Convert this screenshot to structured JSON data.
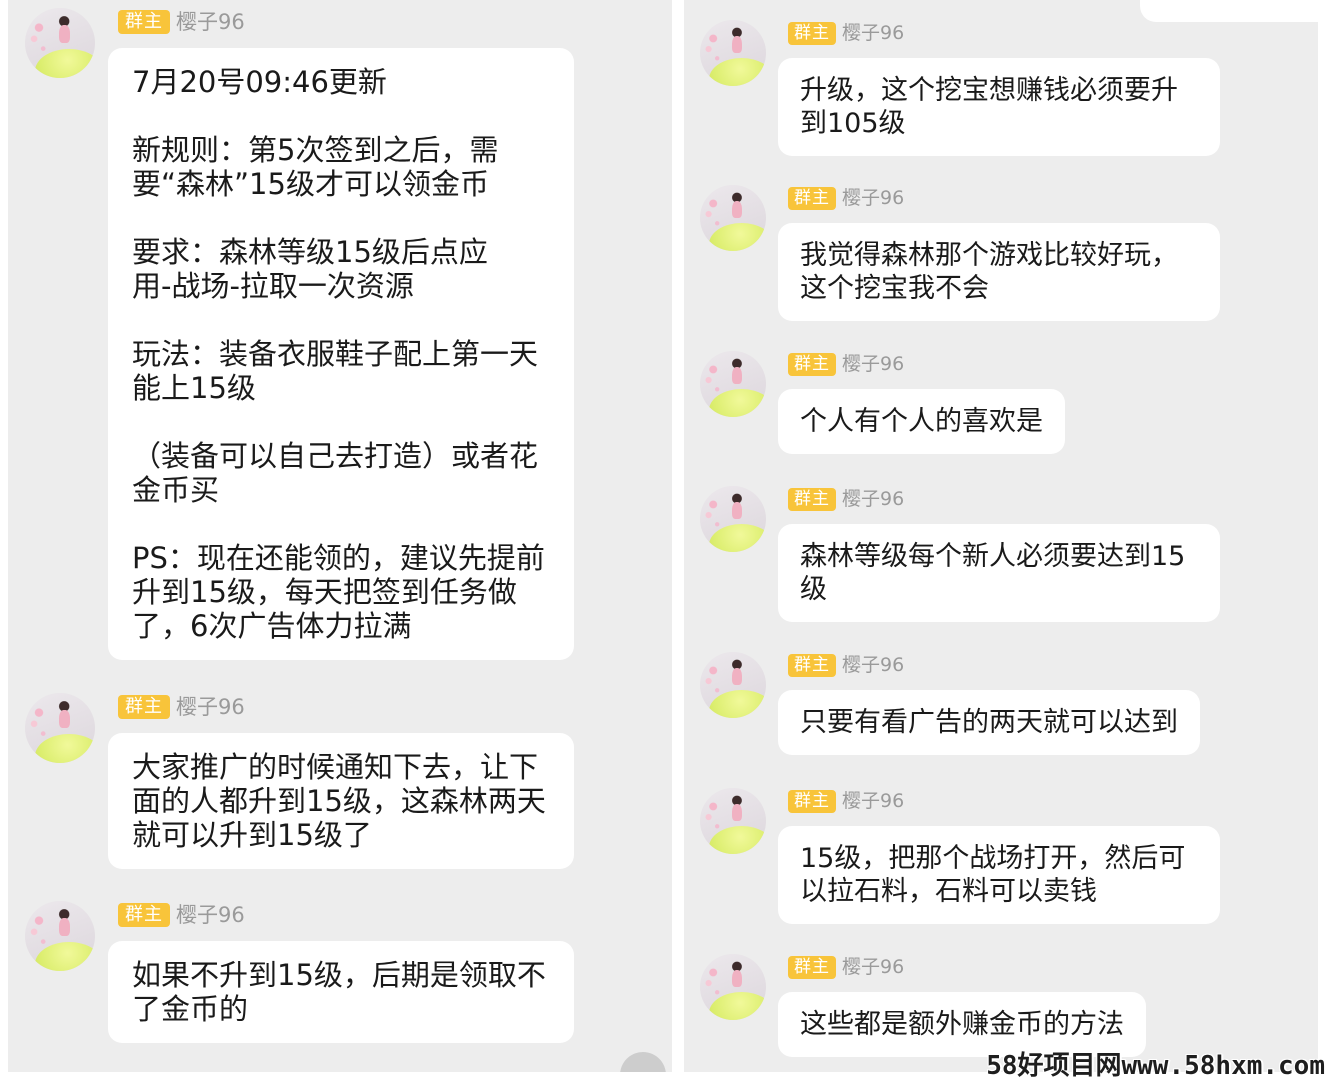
{
  "avatar_icon": "girl-in-green-dress-avatar",
  "colors": {
    "panel_bg": "#ededed",
    "bubble_bg": "#ffffff",
    "badge_bg": "#f8c43a",
    "badge_text": "#ffffff",
    "sender_name": "#9a9a9a",
    "message_text": "#1a1a1a"
  },
  "left": {
    "messages": [
      {
        "badge": "群主",
        "sender": "樱子96",
        "paragraphs": [
          [
            "7月20号09:46更新"
          ],
          [
            "新规则：第5次签到之后，需",
            "要“森林”15级才可以领金币"
          ],
          [
            "要求：森林等级15级后点应",
            "用-战场-拉取一次资源"
          ],
          [
            "玩法：装备衣服鞋子配上第一天",
            "能上15级"
          ],
          [
            "（装备可以自己去打造）或者花",
            "金币买"
          ],
          [
            "PS：现在还能领的，建议先提前",
            "升到15级，每天把签到任务做",
            "了，6次广告体力拉满"
          ]
        ]
      },
      {
        "badge": "群主",
        "sender": "樱子96",
        "paragraphs": [
          [
            "大家推广的时候通知下去，让下",
            "面的人都升到15级，这森林两天",
            "就可以升到15级了"
          ]
        ]
      },
      {
        "badge": "群主",
        "sender": "樱子96",
        "paragraphs": [
          [
            "如果不升到15级，后期是领取不",
            "了金币的"
          ]
        ]
      }
    ]
  },
  "right": {
    "messages": [
      {
        "badge": "群主",
        "sender": "樱子96",
        "lines": [
          "升级，这个挖宝想赚钱必须要升",
          "到105级"
        ]
      },
      {
        "badge": "群主",
        "sender": "樱子96",
        "lines": [
          "我觉得森林那个游戏比较好玩，",
          "这个挖宝我不会"
        ]
      },
      {
        "badge": "群主",
        "sender": "樱子96",
        "lines": [
          "个人有个人的喜欢是"
        ]
      },
      {
        "badge": "群主",
        "sender": "樱子96",
        "lines": [
          "森林等级每个新人必须要达到15",
          "级"
        ]
      },
      {
        "badge": "群主",
        "sender": "樱子96",
        "lines": [
          "只要有看广告的两天就可以达到"
        ]
      },
      {
        "badge": "群主",
        "sender": "樱子96",
        "lines": [
          "15级，把那个战场打开，然后可",
          "以拉石料，石料可以卖钱"
        ]
      },
      {
        "badge": "群主",
        "sender": "樱子96",
        "lines": [
          "这些都是额外赚金币的方法"
        ]
      }
    ]
  },
  "watermark": "58好项目网www.58hxm.com"
}
